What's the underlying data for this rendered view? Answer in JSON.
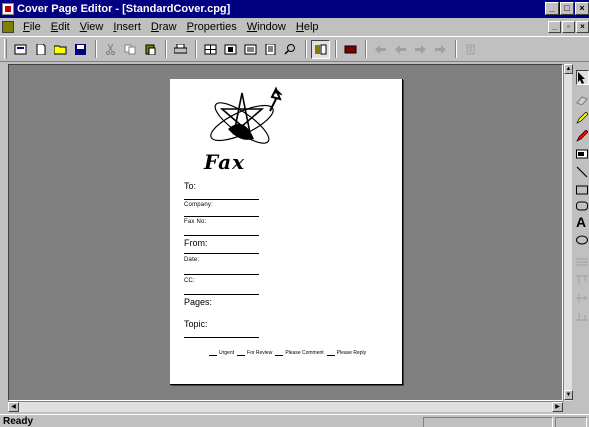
{
  "window": {
    "title": "Cover Page Editor - [StandardCover.cpg]",
    "minimize_glyph": "_",
    "maximize_glyph": "□",
    "close_glyph": "×"
  },
  "menu": {
    "items": [
      "File",
      "Edit",
      "View",
      "Insert",
      "Draw",
      "Properties",
      "Window",
      "Help"
    ],
    "mdi_minimize_glyph": "_",
    "mdi_restore_glyph": "▫",
    "mdi_close_glyph": "×"
  },
  "toolbar": {
    "icons": [
      "new-doc-icon",
      "new-page-icon",
      "open-folder-icon",
      "save-icon",
      "cut-icon",
      "copy-icon",
      "paste-icon",
      "print-icon",
      "grid-icon",
      "fit-page-icon",
      "fit-width-icon",
      "page-icon",
      "zoom-icon",
      "fax-properties-icon",
      "color-icon",
      "arrow-left-icon",
      "arrow-left-2-icon",
      "arrow-right-icon",
      "arrow-right-2-icon",
      "align-icon"
    ]
  },
  "cover_page": {
    "logo_text": "Fax",
    "fields": {
      "to": "To:",
      "company": "Company:",
      "fax_no": "Fax No:",
      "from": "From:",
      "date": "Date:",
      "cc": "CC:",
      "pages": "Pages:",
      "topic": "Topic:"
    },
    "checkboxes": [
      "Urgent",
      "For Review",
      "Please Comment",
      "Please Reply"
    ]
  },
  "drawing_tools": [
    "select-arrow-icon",
    "eraser-icon",
    "pencil-icon",
    "highlighter-icon",
    "text-frame-icon",
    "line-icon",
    "rectangle-icon",
    "rounded-rect-icon",
    "text-tool-icon",
    "ellipse-icon",
    "spacing-icon",
    "align-top-icon",
    "align-middle-icon",
    "distribute-icon"
  ],
  "text_tool_glyph": "A",
  "scroll": {
    "up_glyph": "▲",
    "down_glyph": "▼",
    "left_glyph": "◀",
    "right_glyph": "▶"
  },
  "status": {
    "text": "Ready"
  },
  "colors": {
    "titlebar": "#000080",
    "workspace": "#808080",
    "chrome": "#c0c0c0"
  }
}
